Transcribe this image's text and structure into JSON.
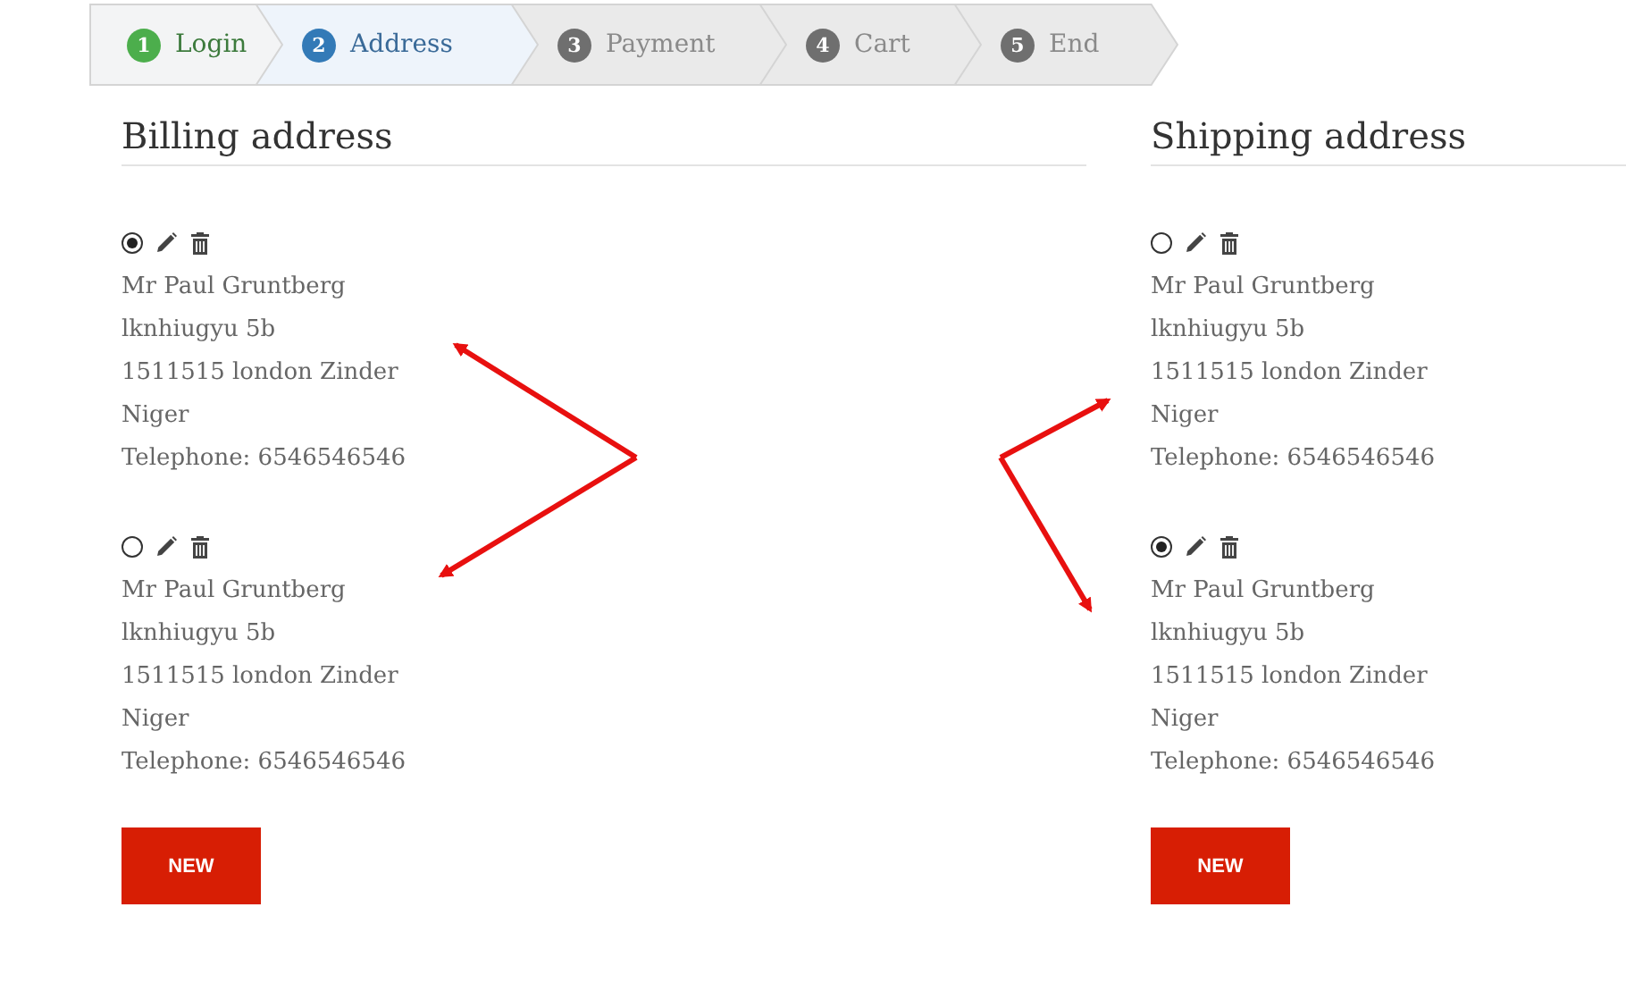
{
  "steps": [
    {
      "number": "1",
      "label": "Login",
      "completed": true,
      "selected": false
    },
    {
      "number": "2",
      "label": "Address",
      "completed": false,
      "selected": true
    },
    {
      "number": "3",
      "label": "Payment",
      "completed": false,
      "selected": false
    },
    {
      "number": "4",
      "label": "Cart",
      "completed": false,
      "selected": false
    },
    {
      "number": "5",
      "label": "End",
      "completed": false,
      "selected": false
    }
  ],
  "sections": [
    {
      "title": "Billing address",
      "addresses": [
        {
          "selected": true,
          "lines": [
            "Mr Paul Gruntberg",
            "lknhiugyu 5b",
            "1511515 london Zinder",
            "Niger",
            "Telephone: 6546546546"
          ]
        },
        {
          "selected": false,
          "lines": [
            "Mr Paul Gruntberg",
            "lknhiugyu 5b",
            "1511515 london Zinder",
            "Niger",
            "Telephone: 6546546546"
          ]
        }
      ],
      "button": "NEW"
    },
    {
      "title": "Shipping address",
      "addresses": [
        {
          "selected": false,
          "lines": [
            "Mr Paul Gruntberg",
            "lknhiugyu 5b",
            "1511515 london Zinder",
            "Niger",
            "Telephone: 6546546546"
          ]
        },
        {
          "selected": true,
          "lines": [
            "Mr Paul Gruntberg",
            "lknhiugyu 5b",
            "1511515 london Zinder",
            "Niger",
            "Telephone: 6546546546"
          ]
        }
      ],
      "button": "NEW"
    }
  ]
}
